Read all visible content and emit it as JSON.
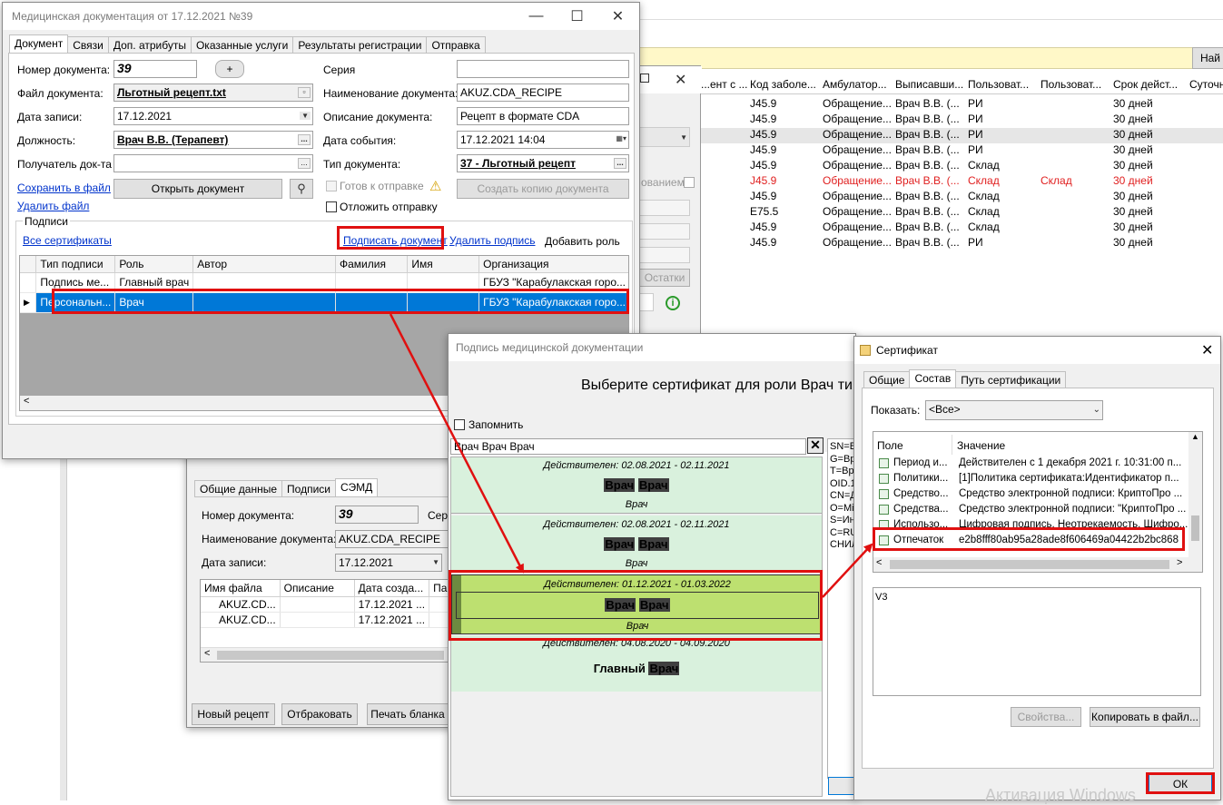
{
  "bg_table": {
    "find_button": "Най",
    "headers": [
      "...ент с ...",
      "Код заболе...",
      "Амбулатор...",
      "Выписавши...",
      "Пользоват...",
      "Пользоват...",
      "Срок дейст...",
      "Суточна"
    ],
    "rows": [
      {
        "code": "J45.9",
        "amb": "Обращение...",
        "doc": "Врач В.В. (...",
        "u1": "РИ",
        "u2": "",
        "term": "30 дней",
        "red": false,
        "sel": false
      },
      {
        "code": "J45.9",
        "amb": "Обращение...",
        "doc": "Врач В.В. (...",
        "u1": "РИ",
        "u2": "",
        "term": "30 дней",
        "red": false,
        "sel": false
      },
      {
        "code": "J45.9",
        "amb": "Обращение...",
        "doc": "Врач В.В. (...",
        "u1": "РИ",
        "u2": "",
        "term": "30 дней",
        "red": false,
        "sel": true
      },
      {
        "code": "J45.9",
        "amb": "Обращение...",
        "doc": "Врач В.В. (...",
        "u1": "РИ",
        "u2": "",
        "term": "30 дней",
        "red": false,
        "sel": false
      },
      {
        "code": "J45.9",
        "amb": "Обращение...",
        "doc": "Врач В.В. (...",
        "u1": "Склад",
        "u2": "",
        "term": "30 дней",
        "red": false,
        "sel": false
      },
      {
        "code": "J45.9",
        "amb": "Обращение...",
        "doc": "Врач В.В. (...",
        "u1": "Склад",
        "u2": "Склад",
        "term": "30 дней",
        "red": true,
        "sel": false
      },
      {
        "code": "J45.9",
        "amb": "Обращение...",
        "doc": "Врач В.В. (...",
        "u1": "Склад",
        "u2": "",
        "term": "30 дней",
        "red": false,
        "sel": false
      },
      {
        "code": "E75.5",
        "amb": "Обращение...",
        "doc": "Врач В.В. (...",
        "u1": "Склад",
        "u2": "",
        "term": "30 дней",
        "red": false,
        "sel": false
      },
      {
        "code": "J45.9",
        "amb": "Обращение...",
        "doc": "Врач В.В. (...",
        "u1": "Склад",
        "u2": "",
        "term": "30 дней",
        "red": false,
        "sel": false
      },
      {
        "code": "J45.9",
        "amb": "Обращение...",
        "doc": "Врач В.В. (...",
        "u1": "РИ",
        "u2": "",
        "term": "30 дней",
        "red": false,
        "sel": false
      }
    ],
    "hint_text": "ованием",
    "ostatki": "Остатки"
  },
  "mid_window": {
    "tabs": [
      "Общие данные",
      "Подписи",
      "СЭМД"
    ],
    "active_tab": 2,
    "doc_number_label": "Номер документа:",
    "doc_number": "39",
    "series_label": "Сери",
    "doc_name_label": "Наименование документа:",
    "doc_name": "AKUZ.CDA_RECIPE",
    "date_label": "Дата записи:",
    "date": "17.12.2021",
    "files_headers": [
      "Имя файла",
      "Описание",
      "Дата созда...",
      "Папка"
    ],
    "files": [
      {
        "name": "AKUZ.CD...",
        "desc": "",
        "date": "17.12.2021 ...",
        "folder": ""
      },
      {
        "name": "AKUZ.CD...",
        "desc": "",
        "date": "17.12.2021 ...",
        "folder": ""
      }
    ],
    "btn_new": "Новый рецепт",
    "btn_reject": "Отбраковать",
    "btn_print": "Печать бланка"
  },
  "doc_window": {
    "title": "Медицинская документация от 17.12.2021 №39",
    "tabs": [
      "Документ",
      "Связи",
      "Доп. атрибуты",
      "Оказанные услуги",
      "Результаты регистрации",
      "Отправка"
    ],
    "active_tab": 0,
    "number_label": "Номер документа:",
    "number": "39",
    "plus": "+",
    "file_label": "Файл документа:",
    "file": "Льготный рецепт.txt",
    "date_label": "Дата записи:",
    "date": "17.12.2021",
    "position_label": "Должность:",
    "position": "Врач В.В. (Терапевт)",
    "recipient_label": "Получатель док-та",
    "recipient": "",
    "save_link": "Сохранить в файл",
    "delete_file_link": "Удалить файл",
    "open_doc": "Открыть документ",
    "series_label": "Серия",
    "series": "",
    "name_label": "Наименование документа:",
    "name": "AKUZ.CDA_RECIPE",
    "desc_label": "Описание документа:",
    "desc": "Рецепт в формате CDA",
    "event_label": "Дата события:",
    "event": "17.12.2021 14:04",
    "type_label": "Тип документа:",
    "type": "37 - Льготный рецепт",
    "ready_label": "Готов к отправке",
    "postpone_label": "Отложить отправку",
    "copy_btn": "Создать копию документа",
    "signatures_group": "Подписи",
    "all_certs": "Все сертификаты",
    "sign_doc": "Подписать документ",
    "delete_sign": "Удалить подпись",
    "add_role": "Добавить роль",
    "sig_headers": [
      "Тип подписи",
      "Роль",
      "Автор",
      "Фамилия",
      "Имя",
      "Организация"
    ],
    "sig_rows": [
      {
        "type": "Подпись ме...",
        "role": "Главный врач",
        "author": "",
        "last": "",
        "first": "",
        "org": "ГБУЗ \"Карабулакская горо...",
        "sel": false
      },
      {
        "type": "Персональн...",
        "role": "Врач",
        "author": "",
        "last": "",
        "first": "",
        "org": "ГБУЗ \"Карабулакская горо...",
        "sel": true
      }
    ]
  },
  "sign_window": {
    "title": "Подпись медицинской документации",
    "heading": "Выберите сертификат для роли Врач тип",
    "remember": "Запомнить",
    "filter": "Врач Врач Врач",
    "certs": [
      {
        "valid": "Действителен: 02.08.2021 - 02.11.2021",
        "name1": "Врач",
        "name2": "Врач",
        "role": "Врач"
      },
      {
        "valid": "Действителен: 02.08.2021 - 02.11.2021",
        "name1": "Врач",
        "name2": "Врач",
        "role": "Врач"
      },
      {
        "valid": "Действителен: 01.12.2021 - 01.03.2022",
        "name1": "Врач",
        "name2": "Врач",
        "role": "Врач"
      },
      {
        "valid": "Действителен: 04.08.2020 - 04.09.2020",
        "name1": "Главный",
        "name2": "Врач",
        "role": ""
      }
    ],
    "side_lines": [
      "SN=В",
      "G=Вр",
      "T=Вр",
      "OID.1",
      "CN=Д",
      "O=Мі",
      "S=Ин",
      "C=RU",
      "СНИЛ"
    ]
  },
  "cert_window": {
    "title": "Сертификат",
    "tabs": [
      "Общие",
      "Состав",
      "Путь сертификации"
    ],
    "active_tab": 1,
    "show_label": "Показать:",
    "show_value": "<Все>",
    "col_field": "Поле",
    "col_value": "Значение",
    "rows": [
      {
        "field": "Период и...",
        "value": "Действителен с 1 декабря 2021 г. 10:31:00 п..."
      },
      {
        "field": "Политики...",
        "value": "[1]Политика сертификата:Идентификатор п..."
      },
      {
        "field": "Средство...",
        "value": "Средство электронной подписи: КриптоПро ..."
      },
      {
        "field": "Средства...",
        "value": "Средство электронной подписи: \"КриптоПро ..."
      },
      {
        "field": "Использо...",
        "value": "Цифровая подпись, Неотрекаемость, Шифро..."
      },
      {
        "field": "Отпечаток",
        "value": "e2b8fff80ab95a28ade8f606469a04422b2bc868"
      }
    ],
    "detail": "V3",
    "btn_props": "Свойства...",
    "btn_copy": "Копировать в файл...",
    "btn_ok": "ОК"
  },
  "watermark": "Активация Windows"
}
